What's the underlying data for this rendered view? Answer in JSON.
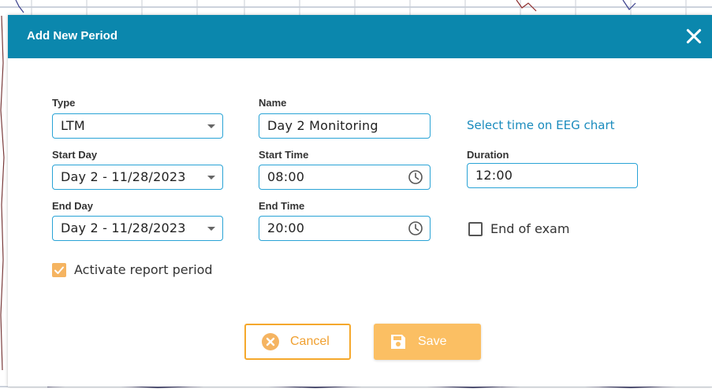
{
  "dialog": {
    "title": "Add New Period",
    "close_icon": "close-icon"
  },
  "form": {
    "type": {
      "label": "Type",
      "value": "LTM"
    },
    "name": {
      "label": "Name",
      "value": "Day 2 Monitoring"
    },
    "select_time_link": "Select time on EEG chart",
    "start_day": {
      "label": "Start Day",
      "value": "Day 2 - 11/28/2023"
    },
    "start_time": {
      "label": "Start Time",
      "value": "08:00"
    },
    "duration": {
      "label": "Duration",
      "value": "12:00"
    },
    "end_day": {
      "label": "End Day",
      "value": "Day 2 - 11/28/2023"
    },
    "end_time": {
      "label": "End Time",
      "value": "20:00"
    },
    "end_of_exam": {
      "label": "End of exam",
      "checked": false
    },
    "activate_report": {
      "label": "Activate report period",
      "checked": true
    }
  },
  "buttons": {
    "cancel_label": "Cancel",
    "save_label": "Save"
  },
  "colors": {
    "header": "#0b87ad",
    "field_border": "#29a3d6",
    "accent_orange": "#f5a82c",
    "save_bg": "#fbbf63",
    "link": "#1a8bbd"
  }
}
